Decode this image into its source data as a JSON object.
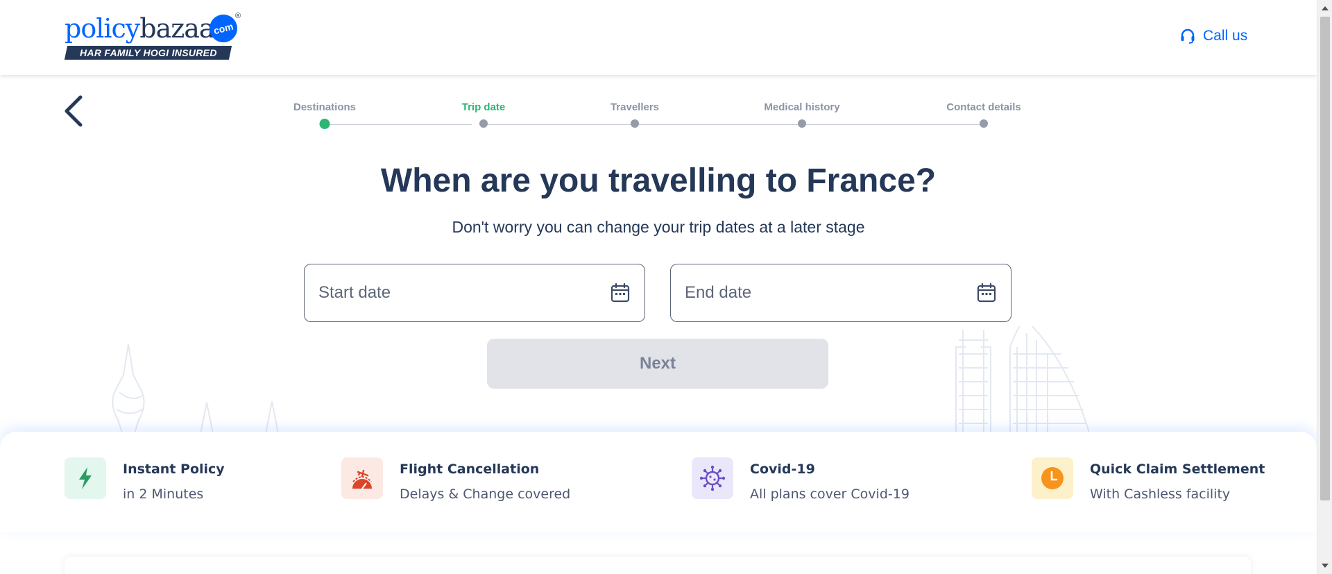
{
  "header": {
    "logo_word_1": "policy",
    "logo_word_2": "bazaar",
    "logo_com": "com",
    "logo_reg": "®",
    "logo_tagline": "HAR FAMILY HOGI INSURED",
    "call_us": "Call us",
    "call_icon": "headset-icon"
  },
  "nav": {
    "back_icon": "chevron-left-icon"
  },
  "stepper": {
    "steps": [
      {
        "label": "Destinations",
        "state": "done"
      },
      {
        "label": "Trip date",
        "state": "active"
      },
      {
        "label": "Travellers",
        "state": "pending"
      },
      {
        "label": "Medical history",
        "state": "pending"
      },
      {
        "label": "Contact details",
        "state": "pending"
      }
    ],
    "colors": {
      "active": "#2bb673",
      "pending": "#959ba8"
    }
  },
  "main": {
    "title": "When are you travelling to France?",
    "subtitle": "Don't worry you can change your trip dates at a later stage",
    "start_date_placeholder": "Start date",
    "end_date_placeholder": "End date",
    "calendar_icon": "calendar-icon",
    "next_label": "Next"
  },
  "features": [
    {
      "title": "Instant Policy",
      "subtitle": "in 2 Minutes",
      "icon": "lightning-icon",
      "bg": "#e3f7ee"
    },
    {
      "title": "Flight Cancellation",
      "subtitle": "Delays & Change covered",
      "icon": "flight-cancel-icon",
      "bg": "#fde9e4"
    },
    {
      "title": "Covid-19",
      "subtitle": "All plans cover Covid-19",
      "icon": "virus-icon",
      "bg": "#ebe7fb"
    },
    {
      "title": "Quick Claim Settlement",
      "subtitle": "With Cashless facility",
      "icon": "clock-icon",
      "bg": "#fdf1cc"
    }
  ],
  "colors": {
    "brand_blue": "#0065ff",
    "navy": "#253858",
    "green": "#2bb673"
  }
}
